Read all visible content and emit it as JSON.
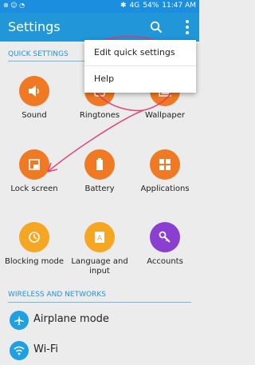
{
  "status_bar": {
    "time": "11:47 AM",
    "battery": "54%",
    "network": "4G"
  },
  "action_bar": {
    "title": "Settings"
  },
  "sections": {
    "quick": "QUICK SETTINGS",
    "wireless": "WIRELESS AND NETWORKS"
  },
  "quick_settings": [
    {
      "label": "Sound",
      "color": "#f07a23"
    },
    {
      "label": "Ringtones",
      "color": "#f07a23"
    },
    {
      "label": "Wallpaper",
      "color": "#f07a23"
    },
    {
      "label": "Lock screen",
      "color": "#f07a23"
    },
    {
      "label": "Battery",
      "color": "#f07a23"
    },
    {
      "label": "Applications",
      "color": "#f07a23"
    },
    {
      "label": "Blocking mode",
      "color": "#f5a623"
    },
    {
      "label": "Language and input",
      "color": "#f5a623"
    },
    {
      "label": "Accounts",
      "color": "#8a3fd1"
    }
  ],
  "wireless_items": [
    {
      "label": "Airplane mode",
      "icon": "airplane-icon"
    },
    {
      "label": "Wi-Fi",
      "icon": "wifi-icon"
    }
  ],
  "popup_menu": [
    {
      "label": "Edit quick settings"
    },
    {
      "label": "Help"
    }
  ],
  "colors": {
    "status_bar": "#1c8ee0",
    "action_bar": "#2196d9",
    "accent": "#2196d9",
    "annotation": "#e03a6a"
  }
}
